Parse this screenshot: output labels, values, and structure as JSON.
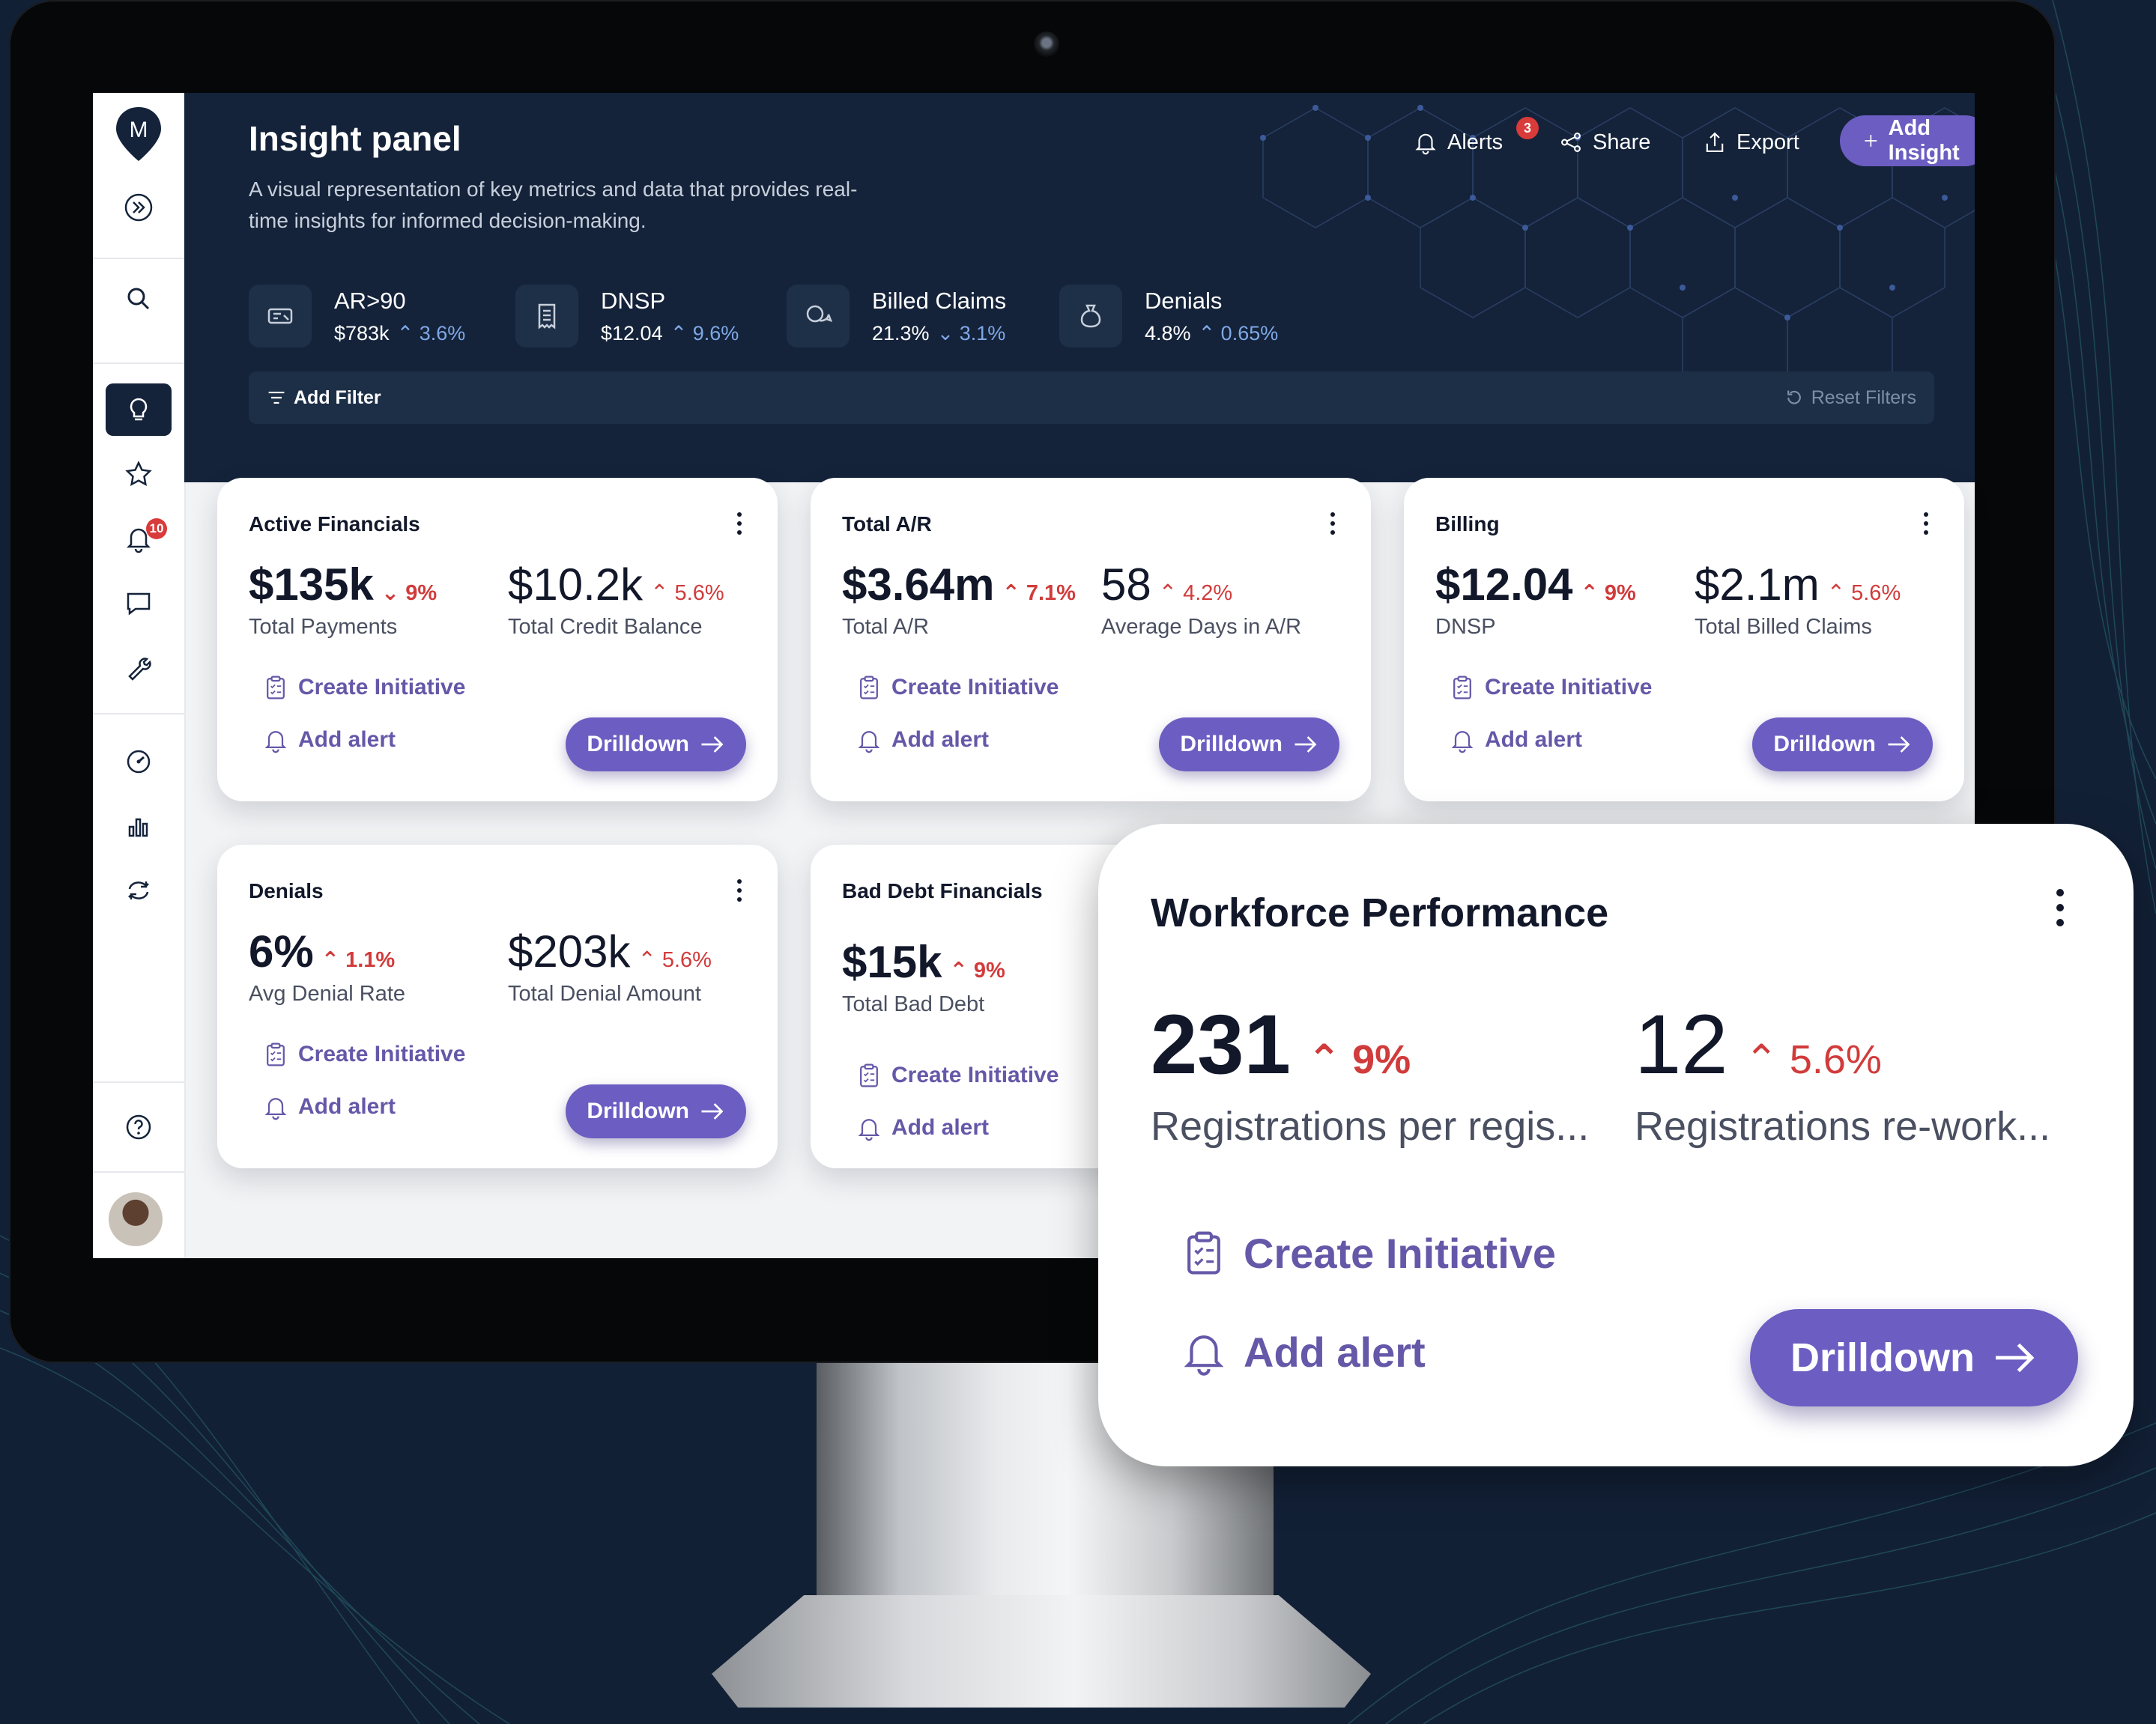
{
  "header": {
    "title": "Insight panel",
    "subtitle": "A visual representation of key metrics and data that provides real-time insights for informed decision-making.",
    "actions": {
      "alerts": "Alerts",
      "alerts_count": "3",
      "share": "Share",
      "export": "Export",
      "add_insight": "Add Insight"
    },
    "kpis": [
      {
        "name": "AR>90",
        "value": "$783k",
        "change": "3.6%",
        "direction": "up",
        "icon": "money-icon"
      },
      {
        "name": "DNSP",
        "value": "$12.04",
        "change": "9.6%",
        "direction": "up",
        "icon": "receipt-icon"
      },
      {
        "name": "Billed Claims",
        "value": "21.3%",
        "change": "3.1%",
        "direction": "down",
        "icon": "chat-money-icon"
      },
      {
        "name": "Denials",
        "value": "4.8%",
        "change": "0.65%",
        "direction": "up",
        "icon": "money-bag-icon"
      }
    ],
    "filters": {
      "add": "Add Filter",
      "reset": "Reset Filters"
    }
  },
  "sidebar": {
    "logo": "M",
    "notifications_count": "10",
    "items": [
      "expand-icon",
      "search-icon",
      "insight-icon",
      "star-icon",
      "bell-icon",
      "chat-icon",
      "wrench-icon",
      "dashboard-icon",
      "bar-chart-icon",
      "sync-icon",
      "help-icon"
    ]
  },
  "cards": [
    {
      "title": "Active Financials",
      "m1": {
        "value": "$135k",
        "change": "9%",
        "direction": "down",
        "label": "Total Payments"
      },
      "m2": {
        "value": "$10.2k",
        "change": "5.6%",
        "direction": "up",
        "label": "Total Credit Balance"
      }
    },
    {
      "title": "Total A/R",
      "m1": {
        "value": "$3.64m",
        "change": "7.1%",
        "direction": "up",
        "label": "Total A/R"
      },
      "m2": {
        "value": "58",
        "change": "4.2%",
        "direction": "up",
        "label": "Average Days in A/R"
      }
    },
    {
      "title": "Billing",
      "m1": {
        "value": "$12.04",
        "change": "9%",
        "direction": "up",
        "label": "DNSP"
      },
      "m2": {
        "value": "$2.1m",
        "change": "5.6%",
        "direction": "up",
        "label": "Total Billed Claims"
      }
    },
    {
      "title": "Denials",
      "m1": {
        "value": "6%",
        "change": "1.1%",
        "direction": "up",
        "label": "Avg Denial Rate"
      },
      "m2": {
        "value": "$203k",
        "change": "5.6%",
        "direction": "up",
        "label": "Total Denial Amount"
      }
    },
    {
      "title": "Bad Debt Financials",
      "m1": {
        "value": "$15k",
        "change": "9%",
        "direction": "up",
        "label": "Total Bad Debt"
      }
    }
  ],
  "workforce": {
    "title": "Workforce Performance",
    "m1": {
      "value": "231",
      "change": "9%",
      "direction": "up",
      "label": "Registrations per regis..."
    },
    "m2": {
      "value": "12",
      "change": "5.6%",
      "direction": "up",
      "label": "Registrations re-work..."
    }
  },
  "card_actions": {
    "create": "Create Initiative",
    "alert": "Add alert",
    "drill": "Drilldown"
  },
  "colors": {
    "header_bg": "#14233a",
    "accent": "#6c5dc2",
    "negative": "#d13b3b",
    "kpi_change": "#7fa8e6"
  }
}
